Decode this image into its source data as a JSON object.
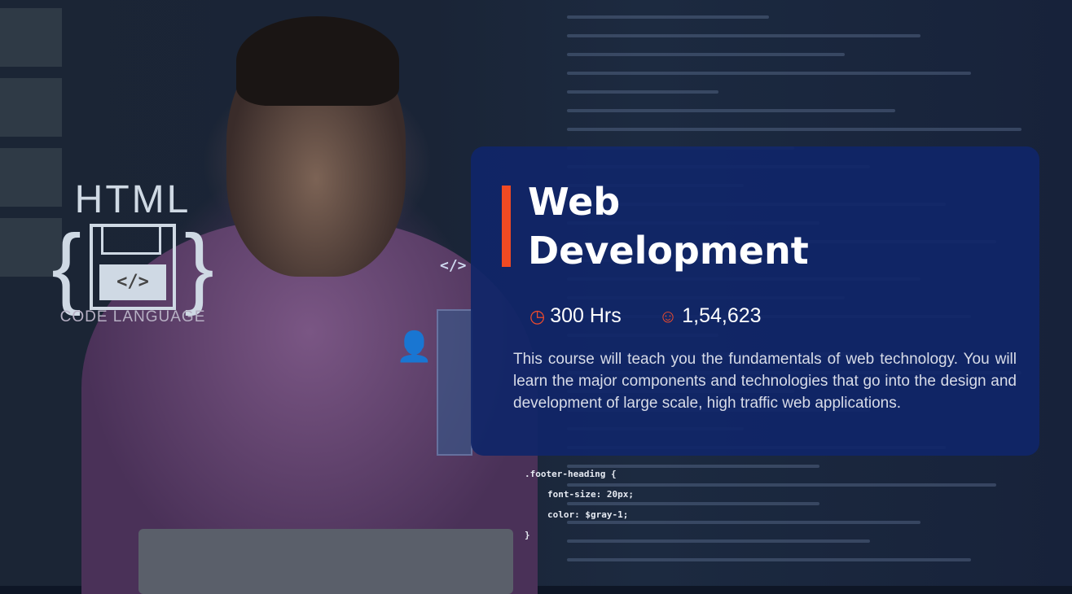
{
  "hero": {
    "logo": {
      "title": "HTML",
      "code_symbol": "</>",
      "subtitle": "CODE LANGUAGE"
    },
    "floating_tag": "</>",
    "code_snippet": [
      ".footer-heading {",
      "font-size: 20px;",
      "color: $gray-1;",
      "}"
    ]
  },
  "course": {
    "title_line1": "Web",
    "title_line2": "Development",
    "duration": "300 Hrs",
    "duration_icon": "clock-icon",
    "learners": "1,54,623",
    "learners_icon": "user-icon",
    "description": "This course will teach you the fundamentals of web technology. You will learn the major components and technologies that go into the design and development of large scale, high traffic web applications.",
    "accent": "#f04a23",
    "card_color": "#102668"
  }
}
